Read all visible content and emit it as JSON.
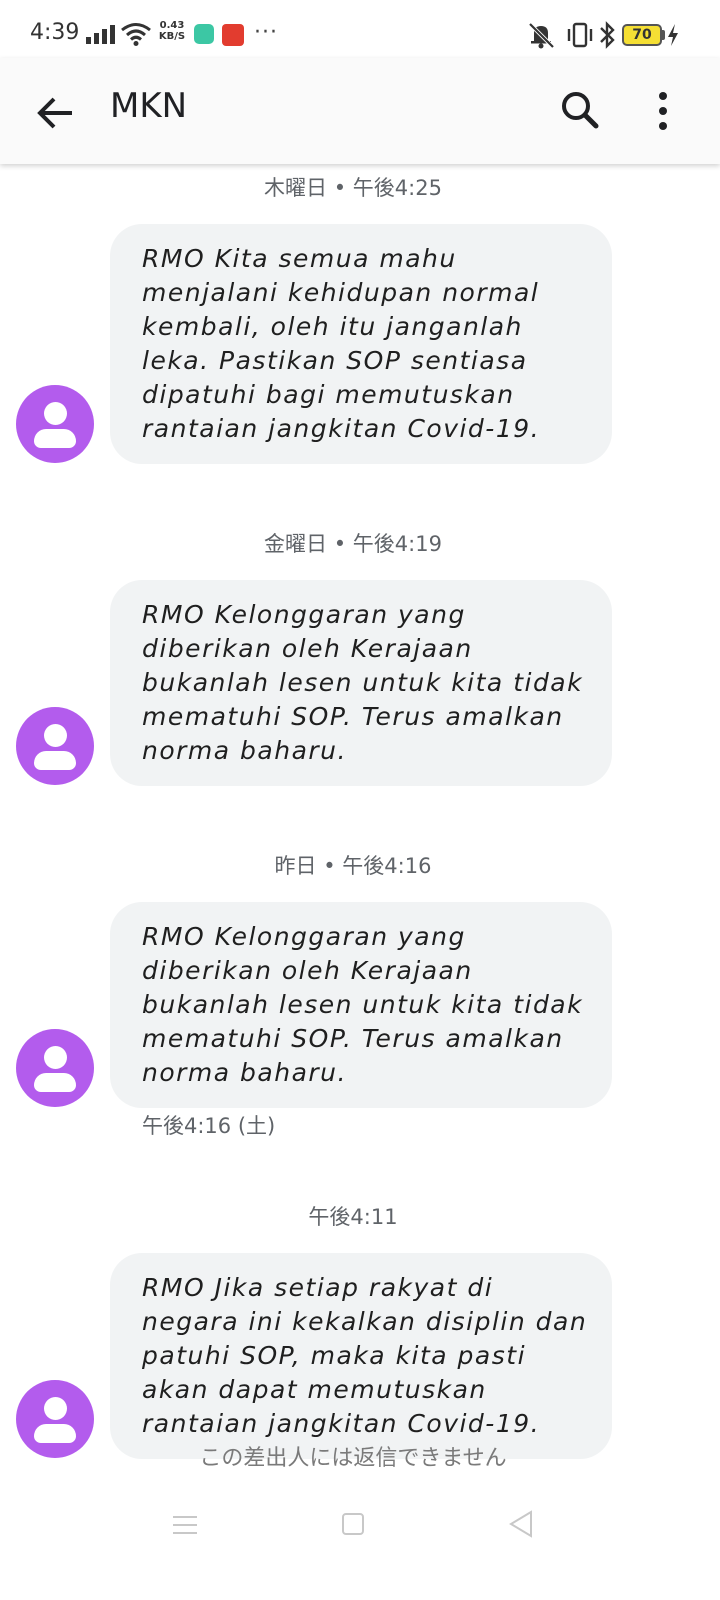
{
  "status_bar": {
    "time": "4:39",
    "net_speed_value": "0.43",
    "net_speed_unit": "KB/S",
    "more_indicator": "···",
    "battery_level": "70"
  },
  "app_bar": {
    "title": "MKN"
  },
  "conversation": [
    {
      "date_label": "木曜日 • 午後4:25",
      "text": "RMO Kita semua mahu menjalani kehidupan normal kembali, oleh itu janganlah leka. Pastikan SOP sentiasa dipatuhi bagi memutuskan rantaian jangkitan Covid-19.",
      "meta": ""
    },
    {
      "date_label": "金曜日 • 午後4:19",
      "text": "RMO Kelonggaran yang diberikan oleh Kerajaan bukanlah lesen untuk kita tidak mematuhi SOP. Terus amalkan norma baharu.",
      "meta": ""
    },
    {
      "date_label": "昨日 • 午後4:16",
      "text": "RMO Kelonggaran yang diberikan oleh Kerajaan bukanlah lesen untuk kita tidak mematuhi SOP. Terus amalkan norma baharu.",
      "meta": "午後4:16 (土)"
    },
    {
      "date_label": "午後4:11",
      "text": "RMO Jika setiap rakyat di negara ini kekalkan disiplin dan patuhi SOP, maka kita pasti akan dapat memutuskan rantaian jangkitan Covid-19.",
      "meta": ""
    }
  ],
  "footer": {
    "no_reply_text": "この差出人には返信できません"
  },
  "colors": {
    "avatar": "#b35ced",
    "bubble": "#f1f3f4",
    "battery": "#f5df34"
  }
}
